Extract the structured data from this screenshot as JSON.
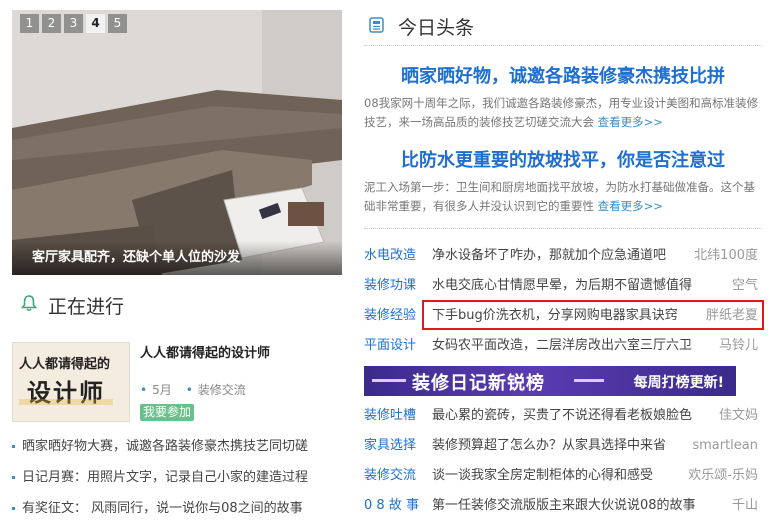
{
  "slider": {
    "pages": [
      "1",
      "2",
      "3",
      "4",
      "5"
    ],
    "active_page": 4,
    "caption": "客厅家具配齐，还缺个单人位的沙发"
  },
  "ongoing": {
    "title": "正在进行",
    "event": {
      "image_line1": "人人都请得起的",
      "image_line2": "设计师",
      "title": "人人都请得起的设计师",
      "meta": [
        "5月",
        "装修交流"
      ],
      "join_label": "我要参加"
    },
    "list": [
      "晒家晒好物大赛，诚邀各路装修豪杰携技艺同切磋",
      "日记月赛：用照片文字，记录自己小家的建造过程",
      "有奖征文： 风雨同行，说一说你与08之间的故事"
    ]
  },
  "today": {
    "title": "今日头条",
    "headlines": [
      {
        "title": "晒家晒好物，诚邀各路装修豪杰携技比拼",
        "desc": "08我家网十周年之际，我们诚邀各路装修豪杰，用专业设计美图和高标准装修技艺，来一场高品质的装修技艺切磋交流大会",
        "more": "查看更多>>"
      },
      {
        "title": "比防水更重要的放坡找平，你是否注意过",
        "desc": "泥工入场第一步：卫生间和厨房地面找平放坡，为防水打基础做准备。这个基础非常重要，有很多人并没认识到它的重要性",
        "more": "查看更多>>"
      }
    ],
    "list1": [
      {
        "cat": "水电改造",
        "text": "净水设备坏了咋办，那就加个应急通道吧",
        "author": "北纬100度"
      },
      {
        "cat": "装修功课",
        "text": "水电交底心甘情愿早晕，为后期不留遗憾值得",
        "author": "空气"
      },
      {
        "cat": "装修经验",
        "text": "下手bug价洗衣机，分享网购电器家具诀窍",
        "author": "胖纸老夏"
      },
      {
        "cat": "平面设计",
        "text": "女码农平面改造，二层洋房改出六室三厅六卫",
        "author": "马铃儿"
      }
    ],
    "banner": {
      "main": "装修日记新锐榜",
      "sub": "每周打榜更新!"
    },
    "list2": [
      {
        "cat": "装修吐槽",
        "text": "最心累的瓷砖，买贵了不说还得看老板娘脸色",
        "author": "佳文妈"
      },
      {
        "cat": "家具选择",
        "text": "装修预算超了怎么办？从家具选择中来省",
        "author": "smartlean"
      },
      {
        "cat": "装修交流",
        "text": "谈一谈我家全房定制柜体的心得和感受",
        "author": "欢乐颂-乐妈"
      },
      {
        "cat": "0 8 故 事",
        "text": "第一任装修交流版版主来跟大伙说说08的故事",
        "author": "千山"
      }
    ]
  },
  "colors": {
    "link_blue": "#1f6fd0",
    "accent_red": "#e01a1a",
    "tag_green": "#6ac08a",
    "banner_purple": "#3b2a8c"
  }
}
